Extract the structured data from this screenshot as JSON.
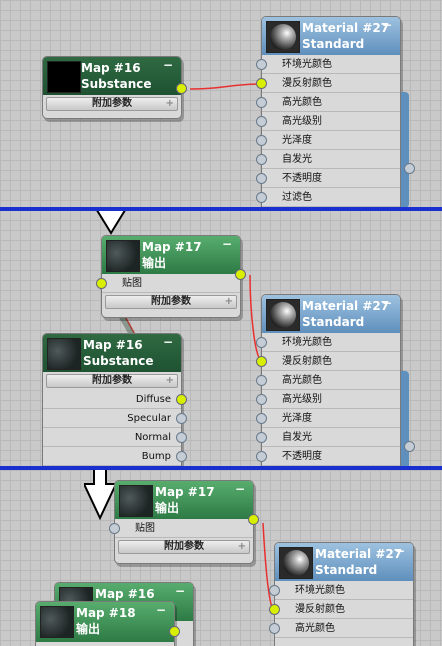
{
  "slots_material": [
    "环境光颜色",
    "漫反射颜色",
    "高光颜色",
    "高光级别",
    "光泽度",
    "自发光",
    "不透明度",
    "过滤色"
  ],
  "panel1": {
    "map16": {
      "name": "Map #16",
      "type": "Substance",
      "param": "附加参数"
    },
    "mat27": {
      "name": "Material #27",
      "type": "Standard"
    }
  },
  "panel2": {
    "map17": {
      "name": "Map #17",
      "type": "输出",
      "param": "附加参数",
      "slot": "贴图"
    },
    "map16": {
      "name": "Map #16",
      "type": "Substance",
      "param": "附加参数",
      "slots": [
        "Diffuse",
        "Specular",
        "Normal",
        "Bump"
      ]
    },
    "mat27": {
      "name": "Material #27",
      "type": "Standard"
    }
  },
  "panel3": {
    "map17": {
      "name": "Map #17",
      "type": "输出",
      "param": "附加参数",
      "slot": "贴图"
    },
    "mat27": {
      "name": "Material #27",
      "type": "Standard"
    },
    "map16": {
      "name": "Map #16"
    },
    "map18": {
      "name": "Map #18",
      "type": "输出"
    }
  },
  "colors": {
    "divider": "#1a2fd0",
    "wire": "#e83030",
    "socket_linked": "#d8f000",
    "green_header": "#2d7a45",
    "blue_header": "#5f8fbd"
  }
}
